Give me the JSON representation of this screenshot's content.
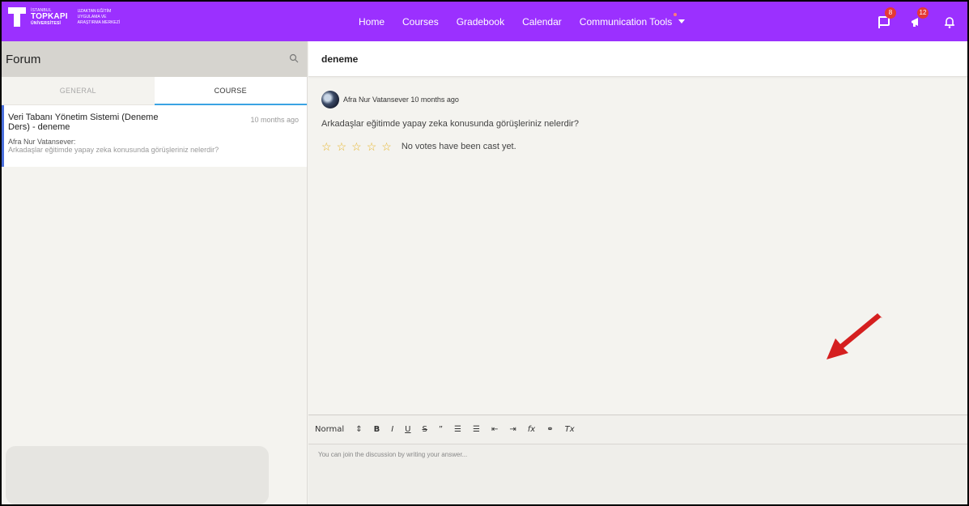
{
  "header": {
    "logo": {
      "line1_small": "İSTANBUL",
      "line1": "TOPKAPI",
      "line1_sub": "ÜNİVERSİTESİ",
      "line2a": "UZAKTAN EĞİTİM",
      "line2b": "UYGULAMA VE",
      "line2c": "ARAŞTIRMA MERKEZİ"
    },
    "nav": [
      "Home",
      "Courses",
      "Gradebook",
      "Calendar",
      "Communication Tools"
    ],
    "badges": {
      "messages": "8",
      "announcements": "12"
    },
    "brand_color": "#9b30ff"
  },
  "forum": {
    "title": "Forum",
    "tabs": [
      "GENERAL",
      "COURSE"
    ],
    "active_tab": "COURSE",
    "thread": {
      "title": "Veri Tabanı Yönetim Sistemi (Deneme Ders) - deneme",
      "time": "10 months ago",
      "author": "Afra Nur Vatansever:",
      "excerpt": "Arkadaşlar eğitimde yapay zeka konusunda görüşleriniz nelerdir?"
    }
  },
  "topic": {
    "title": "deneme",
    "post": {
      "author_time": "Afra Nur Vatansever  10 months ago",
      "text": "Arkadaşlar eğitimde yapay zeka konusunda görüşleriniz nelerdir?",
      "rating_text": "No votes have been cast yet.",
      "stars": 5
    }
  },
  "editor": {
    "format": "Normal",
    "placeholder": "You can join the discussion by writing your answer..."
  }
}
